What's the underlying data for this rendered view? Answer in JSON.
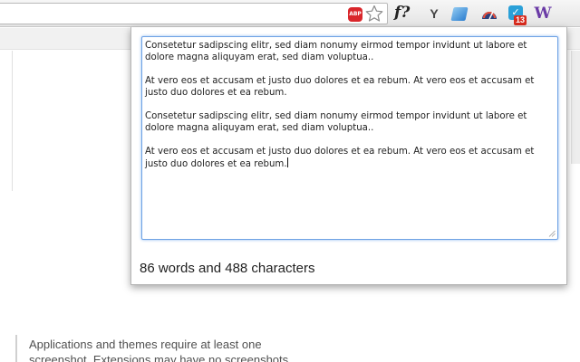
{
  "toolbar": {
    "adblock_label": "ABP",
    "fx_label": "f?",
    "y_label": "Y",
    "badge_count": "13",
    "w_label": "W"
  },
  "popup": {
    "paragraphs": [
      "Consetetur sadipscing elitr, sed diam nonumy eirmod tempor invidunt ut labore et dolore magna aliquyam erat, sed diam voluptua..",
      "At vero eos et accusam et justo duo dolores et ea rebum. At vero eos et accusam et justo duo dolores et ea rebum.",
      "Consetetur sadipscing elitr, sed diam nonumy eirmod tempor invidunt ut labore et dolore magna aliquyam erat, sed diam voluptua..",
      "At vero eos et accusam et justo duo dolores et ea rebum. At vero eos et accusam et justo duo dolores et ea rebum."
    ],
    "counter": "86 words and 488 characters"
  },
  "page": {
    "body_text": "Applications and themes require at least one screenshot. Extensions may have no screenshots."
  },
  "colors": {
    "focus_border": "#6ea2e4",
    "badge": "#d92b1d",
    "adblock": "#d9262b"
  }
}
